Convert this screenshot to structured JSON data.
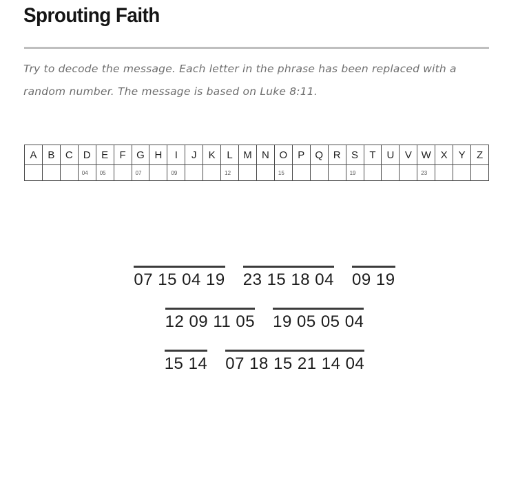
{
  "header": {
    "title": "Sprouting Faith"
  },
  "instructions": {
    "text": "Try to decode the message. Each letter in the phrase has been replaced with a random number. The message is based on Luke 8:11."
  },
  "cipher_table": {
    "letters": [
      "A",
      "B",
      "C",
      "D",
      "E",
      "F",
      "G",
      "H",
      "I",
      "J",
      "K",
      "L",
      "M",
      "N",
      "O",
      "P",
      "Q",
      "R",
      "S",
      "T",
      "U",
      "V",
      "W",
      "X",
      "Y",
      "Z"
    ],
    "numbers": [
      "",
      "",
      "",
      "04",
      "05",
      "",
      "07",
      "",
      "09",
      "",
      "",
      "12",
      "",
      "",
      "15",
      "",
      "",
      "",
      "19",
      "",
      "",
      "",
      "23",
      "",
      "",
      ""
    ]
  },
  "puzzle": {
    "lines": [
      {
        "groups": [
          "07 15 04 19",
          "23 15 18 04",
          "09 19"
        ]
      },
      {
        "groups": [
          "12 09 11 05",
          "19 05 05 04"
        ]
      },
      {
        "groups": [
          "15 14",
          "07 18 15 21 14 04"
        ]
      }
    ]
  },
  "colors": {
    "title": "#151515",
    "divider": "#bfbfbf",
    "instructions": "#6e6e6e",
    "table_border": "#4a4a4a",
    "puzzle_text": "#1c1c1c",
    "puzzle_rule": "#3b3b3b",
    "background": "#ffffff"
  }
}
